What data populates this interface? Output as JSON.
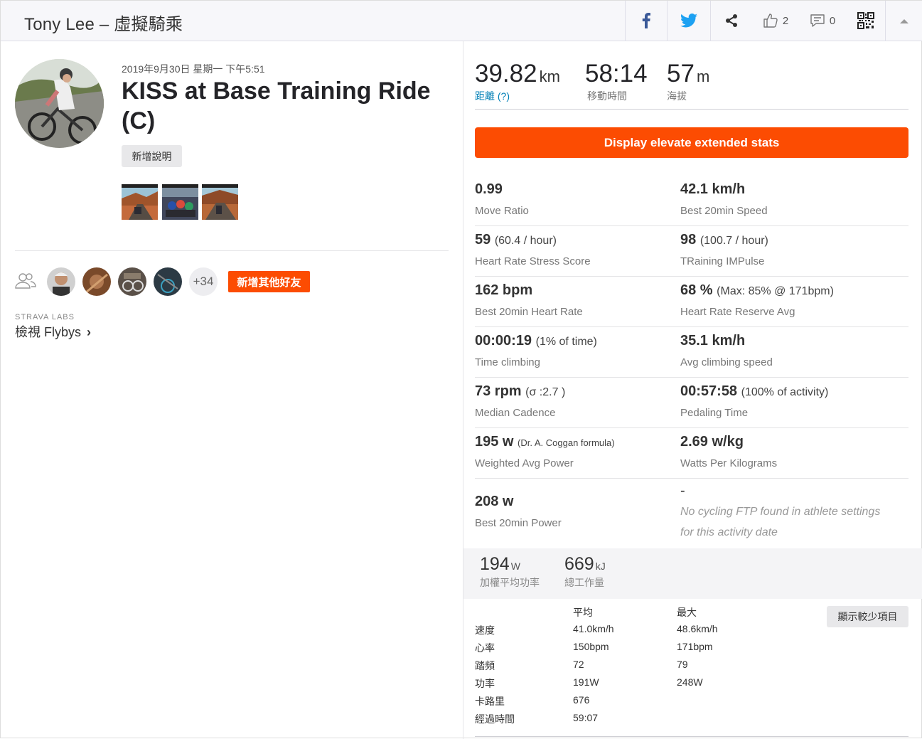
{
  "header": {
    "title": "Tony Lee – 虛擬騎乘",
    "likes": "2",
    "comments": "0"
  },
  "activity": {
    "date": "2019年9月30日 星期一 下午5:51",
    "title": "KISS at Base Training Ride (C)",
    "add_description": "新增說明",
    "more_friends": "+34",
    "add_friends": "新增其他好友",
    "labs_label": "STRAVA LABS",
    "flybys_label": "檢視 Flybys"
  },
  "primary_stats": [
    {
      "value": "39.82",
      "unit": "km",
      "label": "距離 (?)"
    },
    {
      "value": "58:14",
      "unit": "",
      "label": "移動時間"
    },
    {
      "value": "57",
      "unit": "m",
      "label": "海拔"
    }
  ],
  "elevate_button": "Display elevate extended stats",
  "extended_stats": [
    {
      "left": {
        "value": "0.99",
        "extra": "",
        "label": "Move Ratio"
      },
      "right": {
        "value": "42.1 km/h",
        "extra": "",
        "label": "Best 20min Speed"
      }
    },
    {
      "left": {
        "value": "59",
        "extra": "(60.4 / hour)",
        "label": "Heart Rate Stress Score"
      },
      "right": {
        "value": "98",
        "extra": "(100.7 / hour)",
        "label": "TRaining IMPulse"
      }
    },
    {
      "left": {
        "value": "162 bpm",
        "extra": "",
        "label": "Best 20min Heart Rate"
      },
      "right": {
        "value": "68 %",
        "extra": "(Max: 85% @ 171bpm)",
        "label": "Heart Rate Reserve Avg"
      }
    },
    {
      "left": {
        "value": "00:00:19",
        "extra": "(1% of time)",
        "label": "Time climbing"
      },
      "right": {
        "value": "35.1 km/h",
        "extra": "",
        "label": "Avg climbing speed"
      }
    },
    {
      "left": {
        "value": "73 rpm",
        "extra": "(σ :2.7 )",
        "label": "Median Cadence"
      },
      "right": {
        "value": "00:57:58",
        "extra": "(100% of activity)",
        "label": "Pedaling Time"
      }
    },
    {
      "left": {
        "value": "195 w",
        "extra": "(Dr. A. Coggan formula)",
        "label": "Weighted Avg Power"
      },
      "right": {
        "value": "2.69 w/kg",
        "extra": "",
        "label": "Watts Per Kilograms"
      }
    }
  ],
  "last_stat": {
    "left": {
      "value": "208 w",
      "label": "Best 20min Power"
    },
    "right": {
      "value": "-",
      "note": "No cycling FTP found in athlete settings for this activity date"
    }
  },
  "summary": [
    {
      "value": "194",
      "unit": "W",
      "label": "加權平均功率"
    },
    {
      "value": "669",
      "unit": "kJ",
      "label": "總工作量"
    }
  ],
  "table": {
    "headers": [
      "",
      "平均",
      "最大"
    ],
    "rows": [
      [
        "速度",
        "41.0km/h",
        "48.6km/h"
      ],
      [
        "心率",
        "150bpm",
        "171bpm"
      ],
      [
        "踏頻",
        "72",
        "79"
      ],
      [
        "功率",
        "191W",
        "248W"
      ],
      [
        "卡路里",
        "676",
        ""
      ],
      [
        "經過時間",
        "59:07",
        ""
      ]
    ],
    "show_less": "顯示較少項目"
  },
  "colors": {
    "accent": "#fc4c02",
    "link": "#007fb6",
    "facebook": "#3b5998",
    "twitter": "#1da1f2"
  }
}
